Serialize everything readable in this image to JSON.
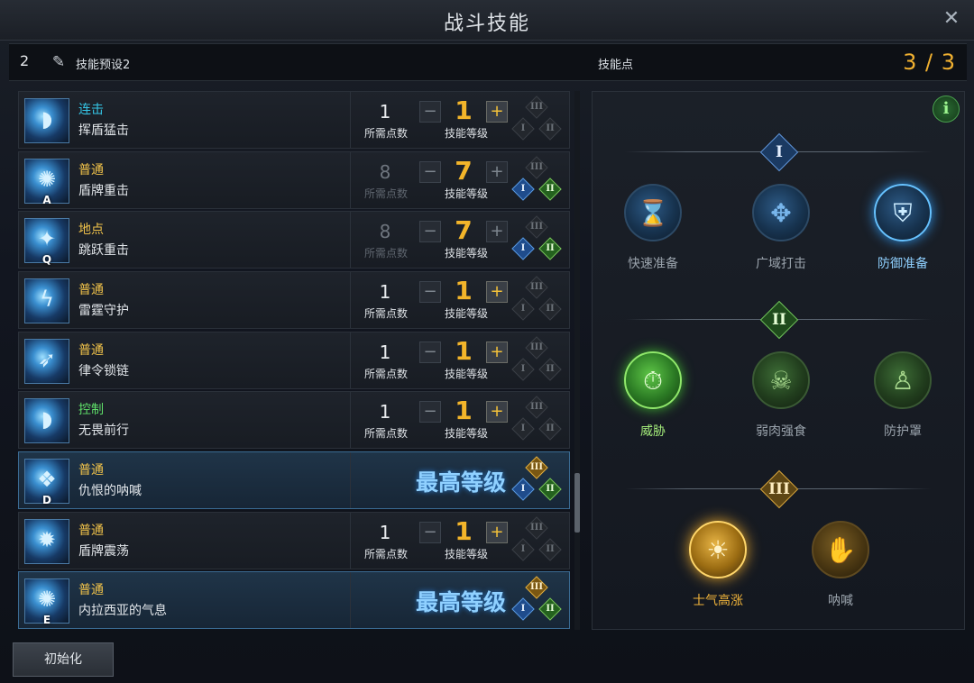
{
  "window": {
    "title": "战斗技能",
    "close_icon": "close-icon"
  },
  "preset": {
    "number": "2",
    "name": "技能预设2",
    "skill_points_label": "技能点",
    "skill_points_value": "3 / 3"
  },
  "labels": {
    "need_points": "所需点数",
    "skill_level": "技能等级",
    "max_level": "最高等级",
    "minus": "−",
    "plus": "+"
  },
  "colors": {
    "combo": "#35c6e6",
    "normal": "#f0c24a",
    "location": "#f0c24a",
    "control": "#5fe06a",
    "accent_gold": "#f0b030"
  },
  "skills": [
    {
      "type": "连击",
      "type_color": "combo",
      "name": "挥盾猛击",
      "key": "",
      "icon": "shield-bash-icon",
      "need": "1",
      "need_dim": false,
      "level": "1",
      "plus_enabled": true,
      "maxed": false,
      "tripods": [
        false,
        false,
        false
      ]
    },
    {
      "type": "普通",
      "type_color": "normal",
      "name": "盾牌重击",
      "key": "A",
      "icon": "shield-strike-icon",
      "need": "8",
      "need_dim": true,
      "level": "7",
      "plus_enabled": false,
      "maxed": false,
      "tripods": [
        true,
        true,
        false
      ]
    },
    {
      "type": "地点",
      "type_color": "location",
      "name": "跳跃重击",
      "key": "Q",
      "icon": "leap-strike-icon",
      "need": "8",
      "need_dim": true,
      "level": "7",
      "plus_enabled": false,
      "maxed": false,
      "tripods": [
        true,
        true,
        false
      ]
    },
    {
      "type": "普通",
      "type_color": "normal",
      "name": "雷霆守护",
      "key": "",
      "icon": "thunder-guard-icon",
      "need": "1",
      "need_dim": false,
      "level": "1",
      "plus_enabled": true,
      "maxed": false,
      "tripods": [
        false,
        false,
        false
      ]
    },
    {
      "type": "普通",
      "type_color": "normal",
      "name": "律令锁链",
      "key": "",
      "icon": "chain-icon",
      "need": "1",
      "need_dim": false,
      "level": "1",
      "plus_enabled": true,
      "maxed": false,
      "tripods": [
        false,
        false,
        false
      ]
    },
    {
      "type": "控制",
      "type_color": "control",
      "name": "无畏前行",
      "key": "",
      "icon": "charge-icon",
      "need": "1",
      "need_dim": false,
      "level": "1",
      "plus_enabled": true,
      "maxed": false,
      "tripods": [
        false,
        false,
        false
      ]
    },
    {
      "type": "普通",
      "type_color": "normal",
      "name": "仇恨的呐喊",
      "key": "D",
      "icon": "war-cry-icon",
      "need": "",
      "need_dim": false,
      "level": "",
      "plus_enabled": false,
      "maxed": true,
      "tripods": [
        true,
        true,
        true
      ]
    },
    {
      "type": "普通",
      "type_color": "normal",
      "name": "盾牌震荡",
      "key": "",
      "icon": "shield-shock-icon",
      "need": "1",
      "need_dim": false,
      "level": "1",
      "plus_enabled": true,
      "maxed": false,
      "tripods": [
        false,
        false,
        false
      ]
    },
    {
      "type": "普通",
      "type_color": "normal",
      "name": "内拉西亚的气息",
      "key": "E",
      "icon": "aura-icon",
      "need": "",
      "need_dim": false,
      "level": "",
      "plus_enabled": false,
      "maxed": true,
      "tripods": [
        true,
        true,
        true
      ]
    }
  ],
  "tripod_tiers": [
    {
      "numeral": "I",
      "nodes": [
        {
          "label": "快速准备",
          "icon": "hourglass-icon",
          "selected": false
        },
        {
          "label": "广域打击",
          "icon": "wide-strike-icon",
          "selected": false
        },
        {
          "label": "防御准备",
          "icon": "shield-plus-icon",
          "selected": true
        }
      ]
    },
    {
      "numeral": "II",
      "nodes": [
        {
          "label": "威胁",
          "icon": "stopwatch-icon",
          "selected": true
        },
        {
          "label": "弱肉强食",
          "icon": "skull-icon",
          "selected": false
        },
        {
          "label": "防护罩",
          "icon": "body-shield-icon",
          "selected": false
        }
      ]
    },
    {
      "numeral": "III",
      "nodes": [
        {
          "label": "士气高涨",
          "icon": "morale-icon",
          "selected": true
        },
        {
          "label": "呐喊",
          "icon": "shout-icon",
          "selected": false
        }
      ]
    }
  ],
  "info_icon": "i",
  "reset_button": "初始化"
}
